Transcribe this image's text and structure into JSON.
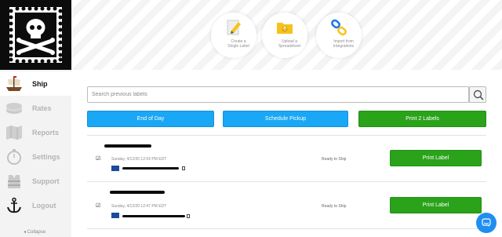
{
  "sidebar": {
    "items": [
      {
        "label": "Ship",
        "icon": "ship-icon",
        "active": true
      },
      {
        "label": "Rates",
        "icon": "money-stack-icon",
        "active": false
      },
      {
        "label": "Reports",
        "icon": "map-icon",
        "active": false
      },
      {
        "label": "Settings",
        "icon": "stopwatch-icon",
        "active": false
      },
      {
        "label": "Support",
        "icon": "life-vest-icon",
        "active": false
      },
      {
        "label": "Logout",
        "icon": "anchor-icon",
        "active": false
      }
    ],
    "collapse_label": "◂ Collapse"
  },
  "create_options": [
    {
      "label_line1": "Create a",
      "label_line2": "Single Label",
      "icon": "pencil-document-icon"
    },
    {
      "label_line1": "Upload a",
      "label_line2": "Spreadsheet",
      "icon": "folder-upload-icon"
    },
    {
      "label_line1": "Import from",
      "label_line2": "Integrations",
      "icon": "chain-link-icon"
    }
  ],
  "search": {
    "placeholder": "Search previous labels",
    "value": ""
  },
  "actions": {
    "end_of_day": "End of Day",
    "schedule_pickup": "Schedule Pickup",
    "print_labels": "Print 2 Labels"
  },
  "labels": [
    {
      "checked": true,
      "date": "Sunday, 4/12/20 12:54 PM EDT",
      "status": "Ready to Ship",
      "print_label": "Print Label"
    },
    {
      "checked": true,
      "date": "Sunday, 4/12/20 12:47 PM EDT",
      "status": "Ready to Ship",
      "print_label": "Print Label"
    }
  ],
  "colors": {
    "blue": "#1aa7f5",
    "green": "#2aa31b",
    "sidebar_bg": "#f3f3f3",
    "chat_blue": "#1f8ef1"
  }
}
